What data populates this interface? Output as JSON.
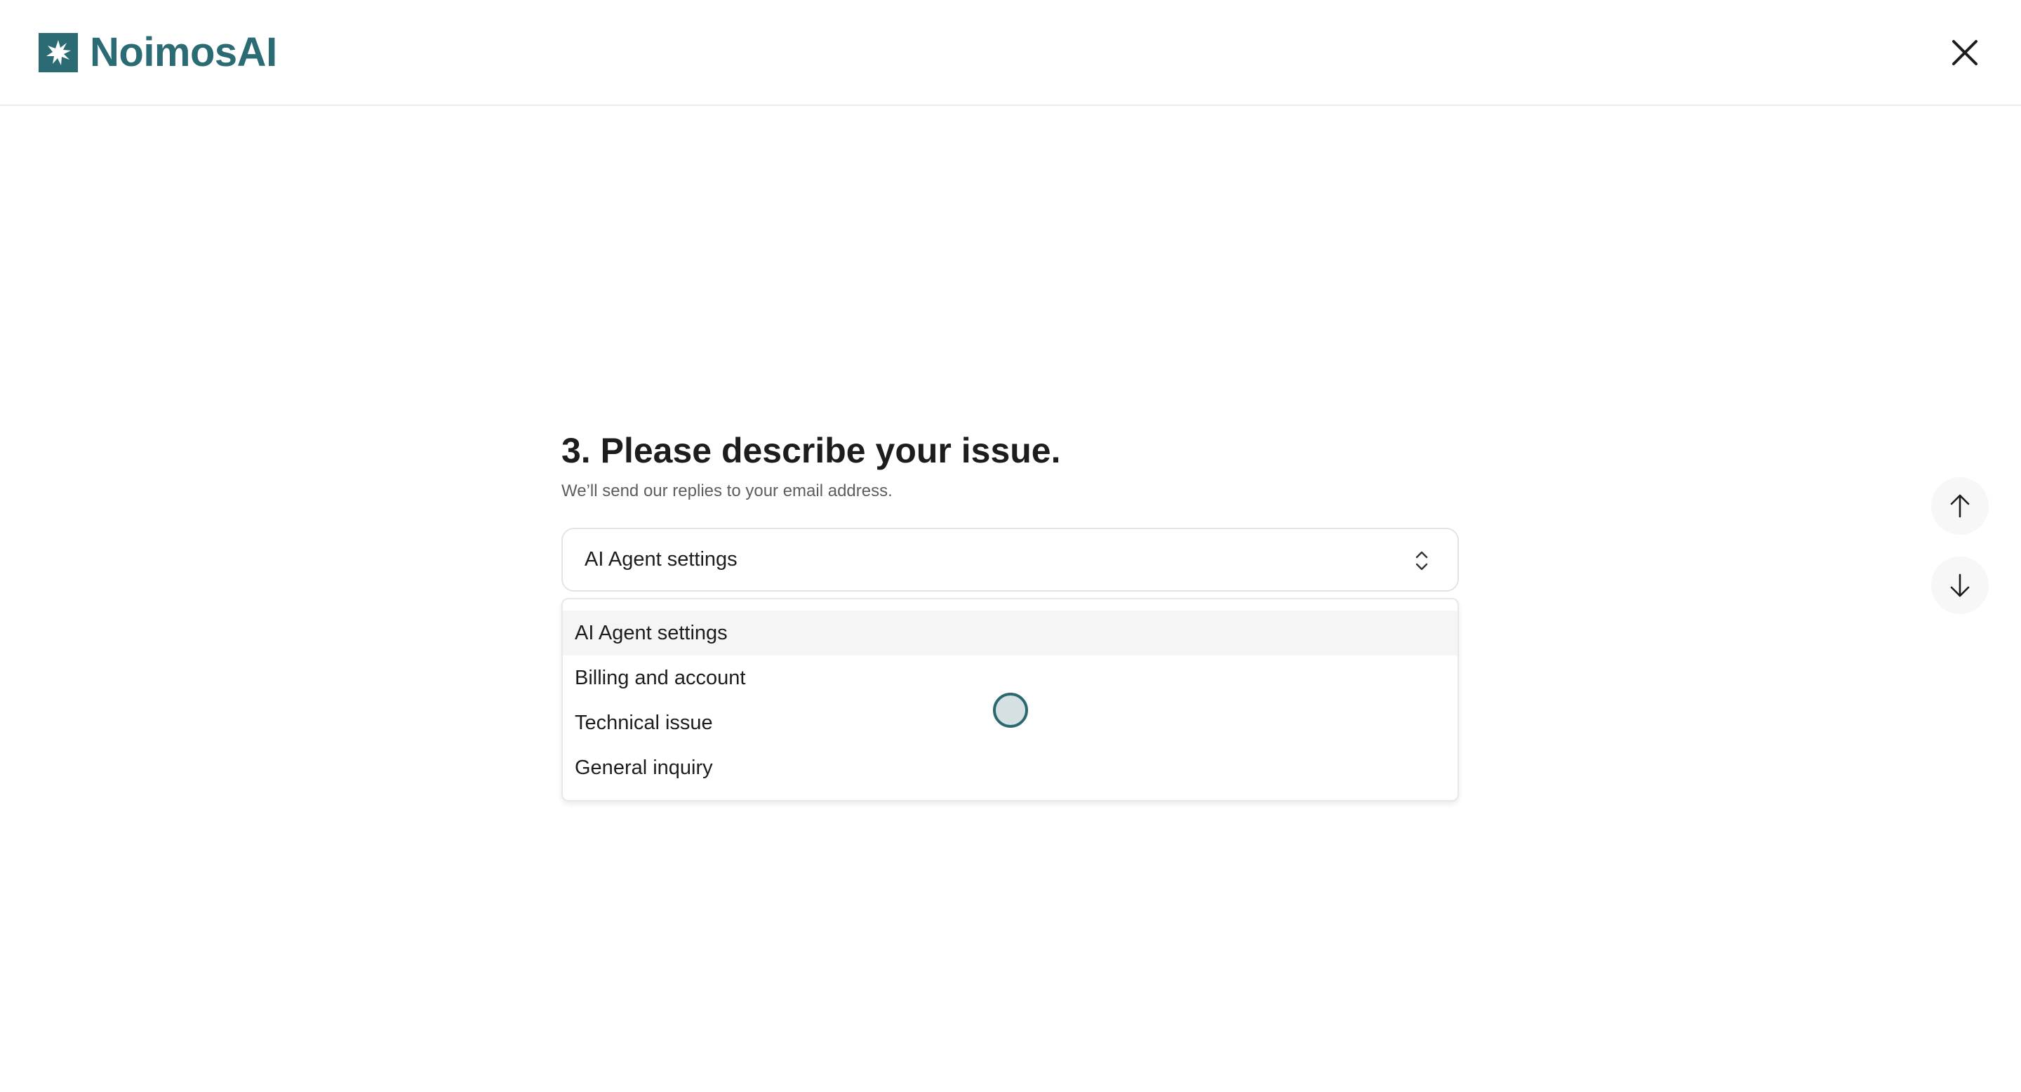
{
  "header": {
    "brand_name": "NoimosAI",
    "brand_color": "#2a6b74",
    "logo_icon": "starburst-logo-icon",
    "close_icon": "close-icon"
  },
  "question": {
    "title": "3. Please describe your issue.",
    "subtitle": "We’ll send our replies to your email address."
  },
  "select": {
    "selected_value": "AI Agent settings",
    "chevron_icon": "chevron-up-down-icon"
  },
  "dropdown": {
    "options": [
      {
        "label": "AI Agent settings",
        "highlighted": true
      },
      {
        "label": "Billing and account",
        "highlighted": false
      },
      {
        "label": "Technical issue",
        "highlighted": false
      },
      {
        "label": "General inquiry",
        "highlighted": false
      }
    ]
  },
  "navigation": {
    "up_icon": "arrow-up-icon",
    "down_icon": "arrow-down-icon"
  }
}
